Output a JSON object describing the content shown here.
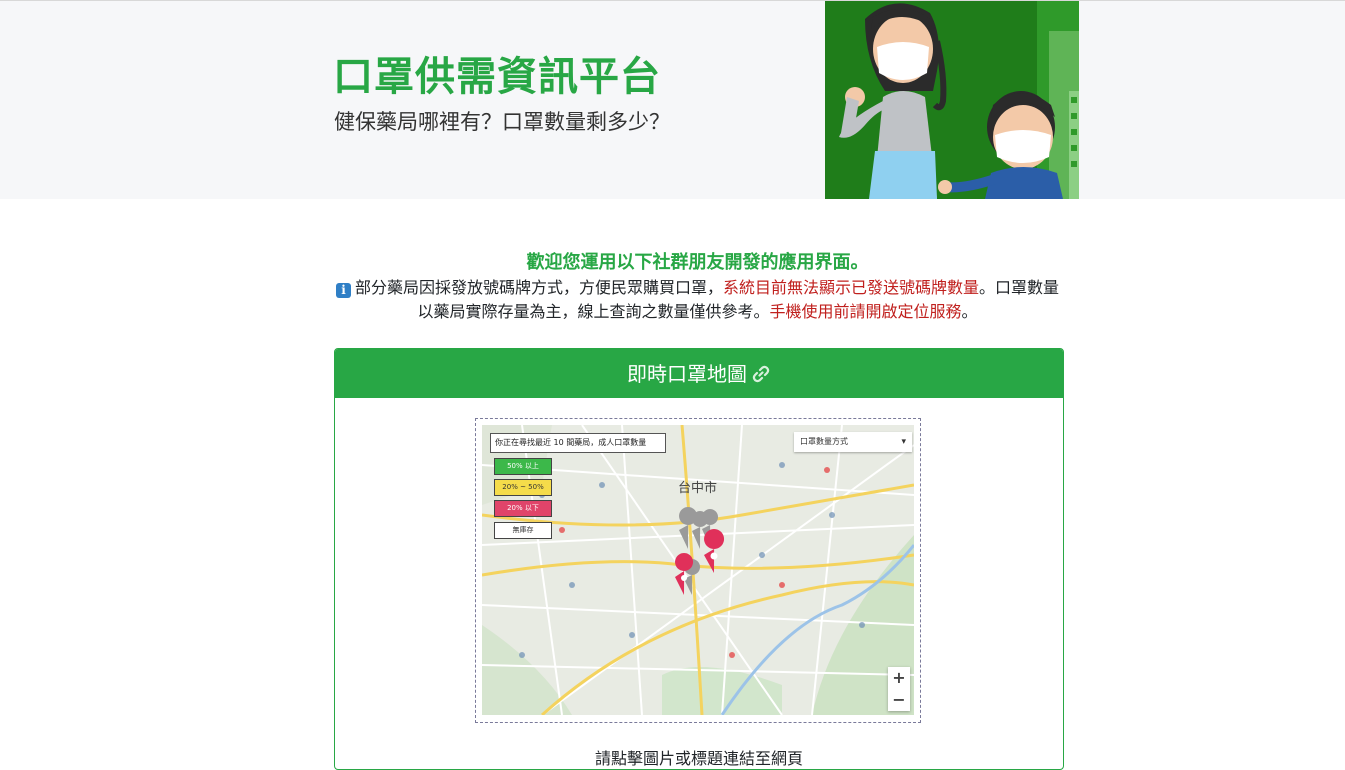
{
  "hero": {
    "title": "口罩供需資訊平台",
    "subtitle": "健保藥局哪裡有？口罩數量剩多少？"
  },
  "intro": {
    "heading": "歡迎您運用以下社群朋友開發的應用界面。",
    "info_icon": "info-icon",
    "text_1": "部分藥局因採發放號碼牌方式，方便民眾購買口罩，",
    "text_red_1": "系統目前無法顯示已發送號碼牌數量",
    "text_2": "。口罩數量以藥局實際存量為主，線上查詢之數量僅供參考。",
    "text_red_2": "手機使用前請開啟定位服務",
    "text_3": "。"
  },
  "card": {
    "title": "即時口罩地圖",
    "link_icon": "link-icon",
    "caption": "請點擊圖片或標題連結至網頁"
  },
  "map": {
    "search_text": "你正在尋找最近 10 間藥局，成人口罩數量",
    "sort_select": "口罩數量方式",
    "city": "台中市",
    "legend": [
      {
        "label": "50% 以上",
        "color": "#3cb84a",
        "text_color": "#ffffff"
      },
      {
        "label": "20% ~ 50%",
        "color": "#f5dc4a",
        "text_color": "#333333"
      },
      {
        "label": "20% 以下",
        "color": "#e0446a",
        "text_color": "#ffffff"
      },
      {
        "label": "無庫存",
        "color": "#ffffff",
        "text_color": "#333333"
      }
    ],
    "zoom_in": "+",
    "zoom_out": "−"
  },
  "colors": {
    "brand_green": "#28a745",
    "warning_red": "#c0201e",
    "hero_bg": "#f6f7f9"
  }
}
